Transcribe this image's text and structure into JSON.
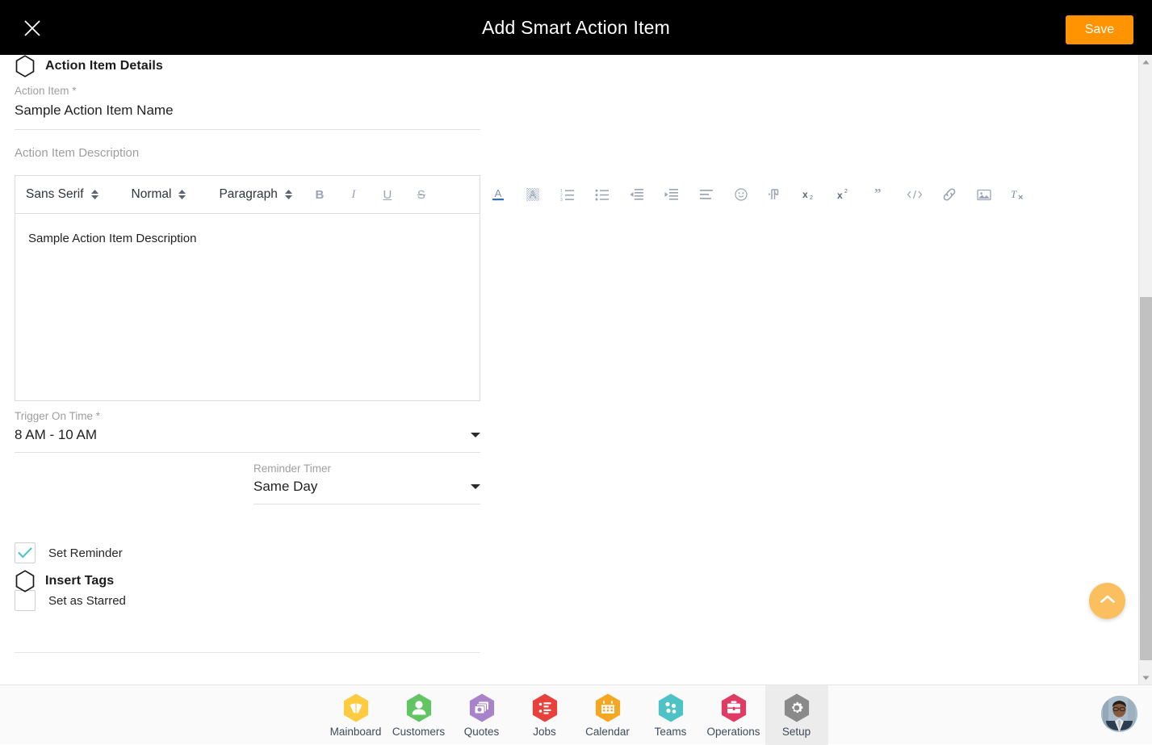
{
  "topbar": {
    "close_icon": "close-icon",
    "title": "Add Smart Action Item",
    "save_label": "Save",
    "save_color": "#ff9300",
    "background": "#000000"
  },
  "form": {
    "sections": [
      {
        "icon": "hexagon-outline-icon",
        "title": "Action Item Details"
      },
      {
        "icon": "hexagon-outline-icon",
        "title": "Insert Tags"
      }
    ],
    "action_item": {
      "label": "Action Item *",
      "value": "Sample Action Item Name",
      "placeholder": "Action Item"
    },
    "description": {
      "label": "Action Item Description",
      "value": "Sample Action Item Description"
    },
    "trigger_on_time": {
      "label": "Trigger On Time *",
      "value": "8 AM - 10 AM"
    },
    "reminder_timer": {
      "label": "Reminder Timer",
      "value": "Same Day"
    },
    "set_reminder": {
      "label": "Set Reminder",
      "checked": true,
      "check_color": "#4ec3cd"
    },
    "set_as_starred": {
      "label": "Set as Starred",
      "checked": false
    }
  },
  "editor": {
    "font_family": "Sans Serif",
    "font_size": "Normal",
    "block_format": "Paragraph",
    "buttons": [
      {
        "name": "bold-button",
        "label": "B"
      },
      {
        "name": "italic-button",
        "label": "I"
      },
      {
        "name": "underline-button",
        "label": "U"
      },
      {
        "name": "strikethrough-button",
        "label": "S"
      }
    ],
    "overflow_buttons": [
      {
        "name": "text-color-icon"
      },
      {
        "name": "background-color-icon"
      },
      {
        "name": "ordered-list-icon"
      },
      {
        "name": "bullet-list-icon"
      },
      {
        "name": "outdent-icon"
      },
      {
        "name": "indent-icon"
      },
      {
        "name": "align-icon"
      },
      {
        "name": "emoji-icon"
      },
      {
        "name": "text-direction-icon"
      },
      {
        "name": "subscript-icon"
      },
      {
        "name": "superscript-icon"
      },
      {
        "name": "blockquote-icon"
      },
      {
        "name": "code-block-icon"
      },
      {
        "name": "link-icon"
      },
      {
        "name": "image-icon"
      },
      {
        "name": "clear-formatting-icon"
      }
    ]
  },
  "fab": {
    "name": "scroll-to-top-button",
    "icon": "chevron-up-icon",
    "color": "#fbbf60"
  },
  "bottom_nav": {
    "items": [
      {
        "label": "Mainboard",
        "icon": "mainboard-icon",
        "color": "#fdcb3f",
        "active": false
      },
      {
        "label": "Customers",
        "icon": "customers-icon",
        "color": "#63c463",
        "active": false
      },
      {
        "label": "Quotes",
        "icon": "quotes-icon",
        "color": "#a983c9",
        "active": false
      },
      {
        "label": "Jobs",
        "icon": "jobs-icon",
        "color": "#e8413c",
        "active": false
      },
      {
        "label": "Calendar",
        "icon": "calendar-icon",
        "color": "#f5a623",
        "active": false
      },
      {
        "label": "Teams",
        "icon": "teams-icon",
        "color": "#4ec3c6",
        "active": false
      },
      {
        "label": "Operations",
        "icon": "operations-icon",
        "color": "#e03b62",
        "active": false
      },
      {
        "label": "Setup",
        "icon": "setup-icon",
        "color": "#8a8a8a",
        "active": true
      }
    ],
    "avatar": "user-avatar"
  }
}
